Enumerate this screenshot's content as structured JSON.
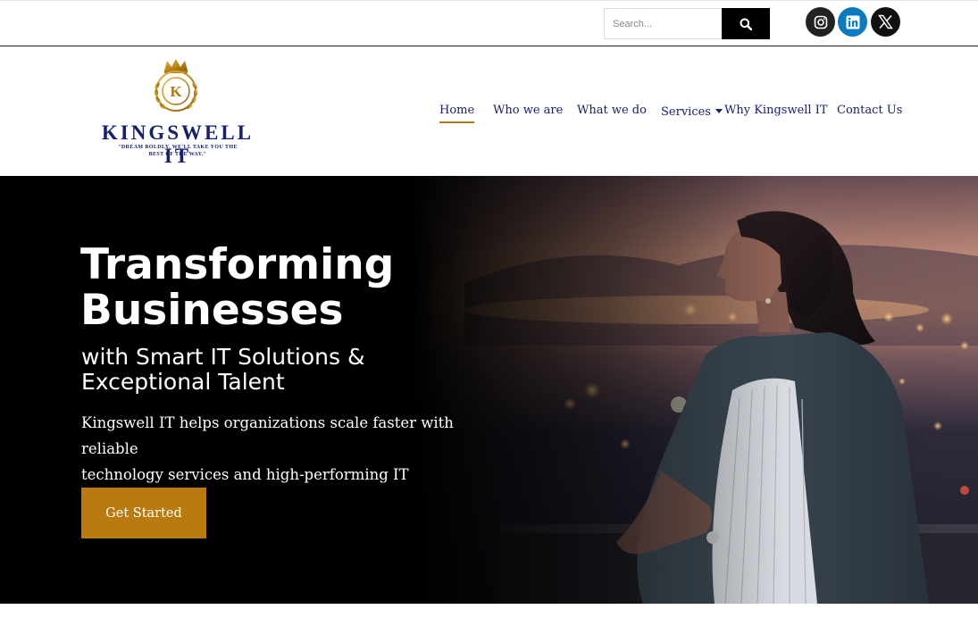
{
  "topbar": {
    "search_placeholder": "Search...",
    "search_icon": "magnifier-icon",
    "social": [
      {
        "name": "instagram-icon",
        "color": "#222222"
      },
      {
        "name": "linkedin-icon",
        "color": "#0a7bbf"
      },
      {
        "name": "x-twitter-icon",
        "color": "#111111"
      }
    ]
  },
  "logo": {
    "letter": "K",
    "name": "KINGSWELL IT",
    "tagline_line1": "\"DREAM BOLDLY. WE'LL TAKE YOU THE",
    "tagline_line2": "BEST OF THE WAY.\"",
    "gold": "#c9931a",
    "navy": "#17206b"
  },
  "nav": {
    "items": [
      {
        "label": "Home",
        "active": true
      },
      {
        "label": "Who we are"
      },
      {
        "label": "What we do"
      },
      {
        "label": "Services",
        "has_dropdown": true
      },
      {
        "label": "Why Kingswell IT"
      },
      {
        "label": "Contact Us"
      }
    ],
    "accent": "#b07a18"
  },
  "hero": {
    "title_line1": "Transforming",
    "title_line2": "Businesses",
    "subtitle_line1": "with Smart IT Solutions &",
    "subtitle_line2": "Exceptional Talent",
    "desc_line1": "Kingswell IT helps organizations scale faster with reliable",
    "desc_line2": "technology services and high-performing IT professionals.",
    "cta_label": "Get Started",
    "cta_color": "#b97a0f"
  }
}
